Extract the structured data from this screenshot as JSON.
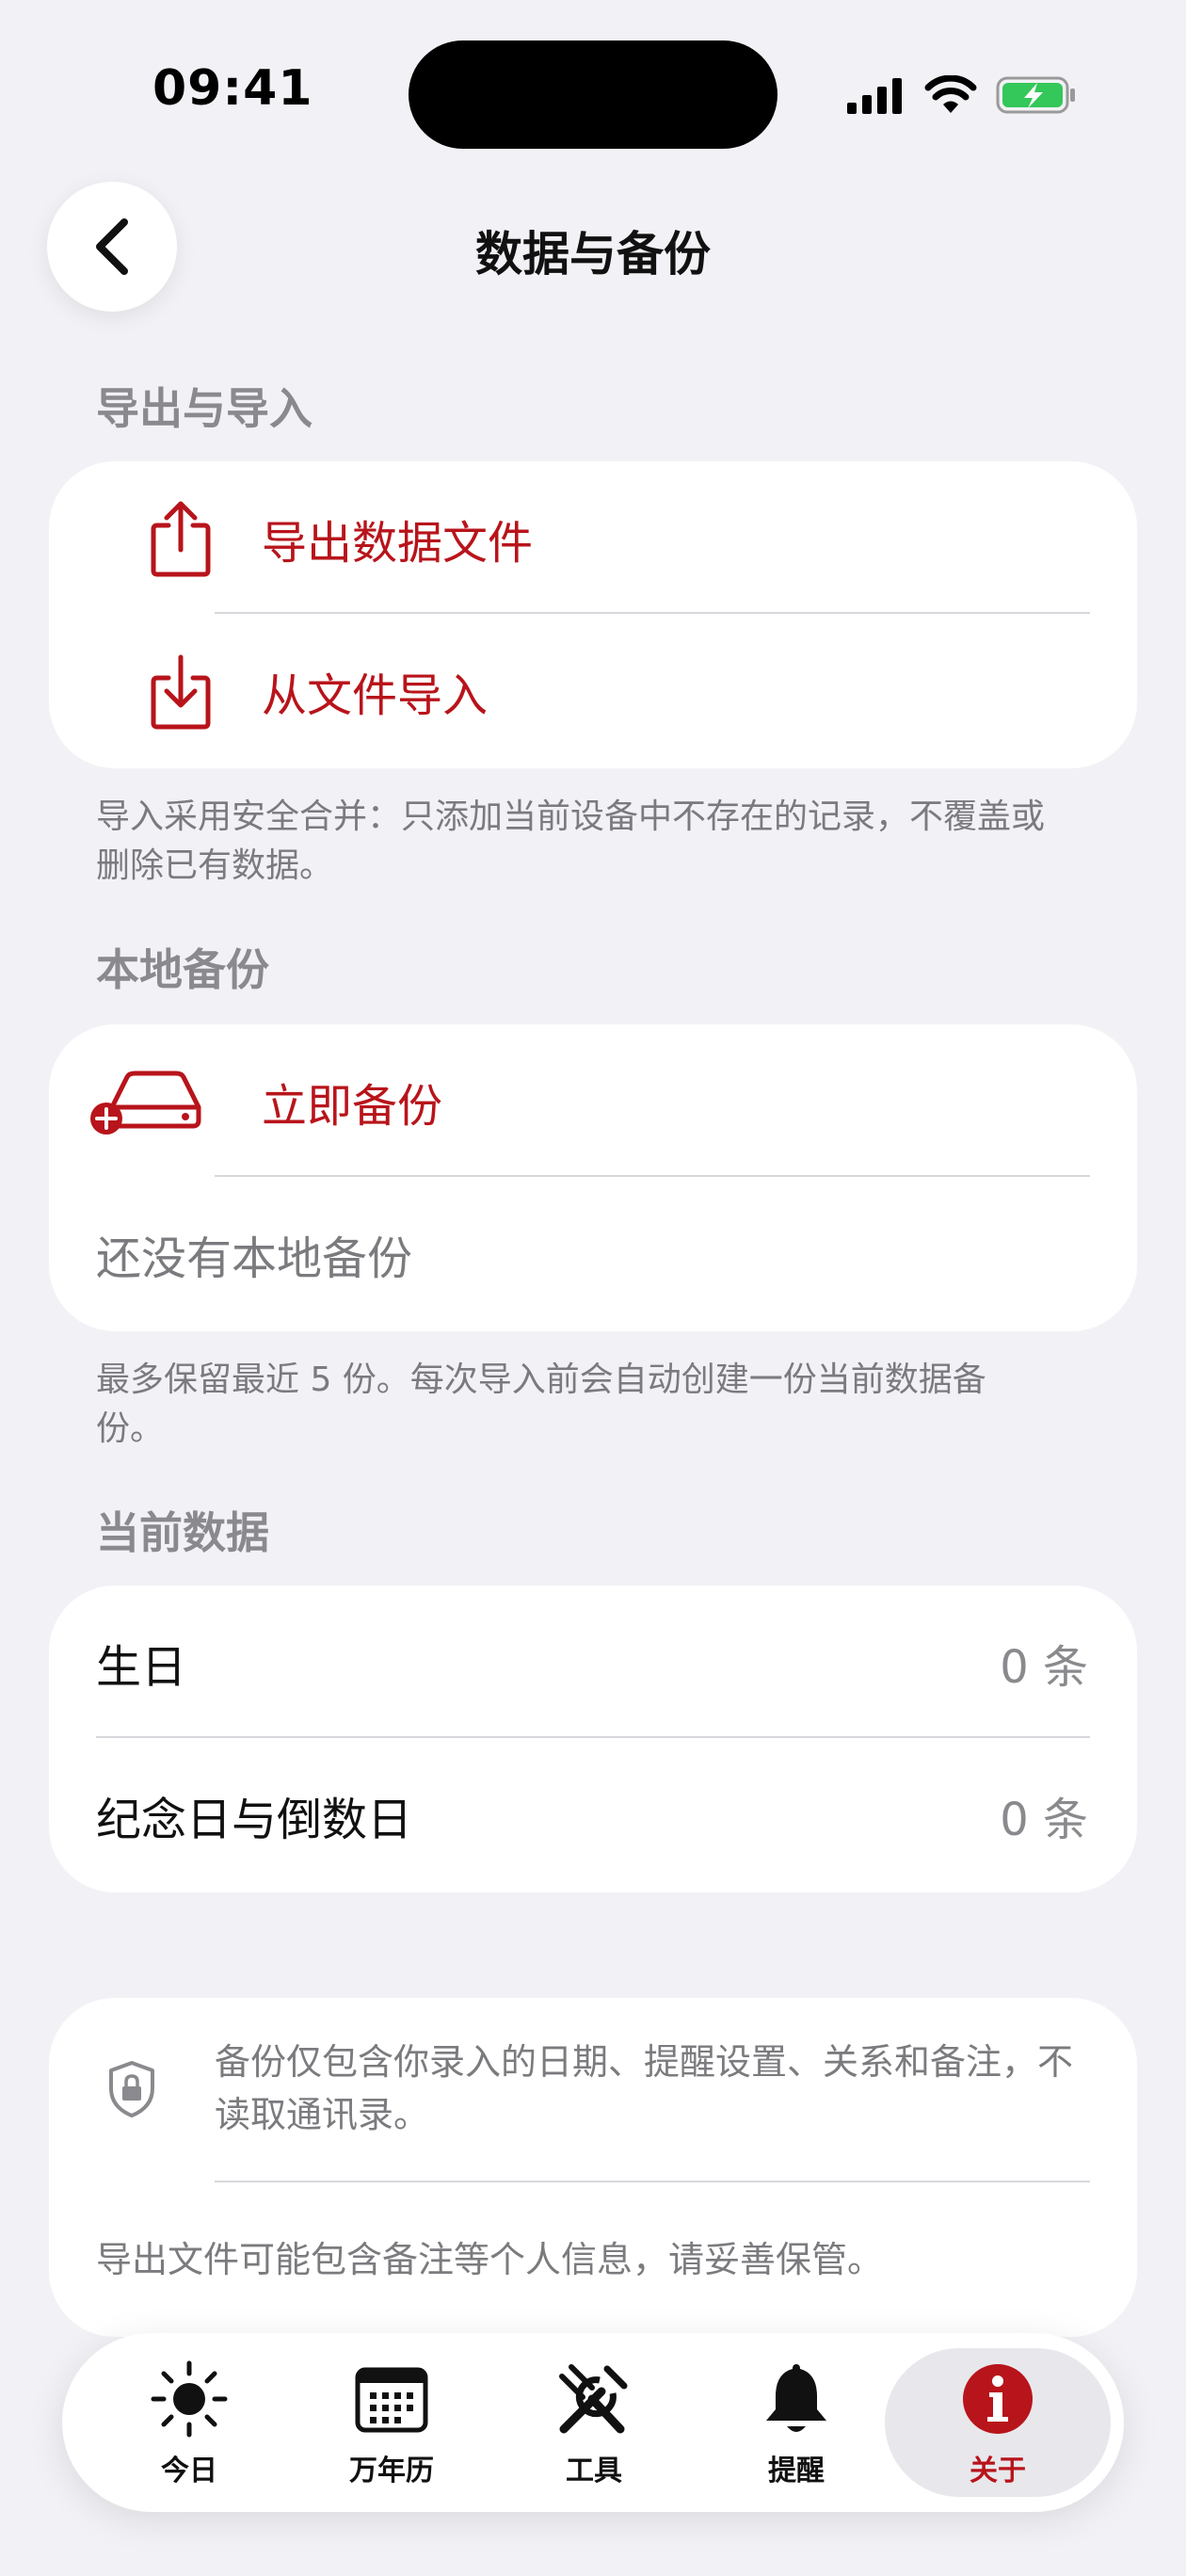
{
  "status_bar": {
    "time": "09:41"
  },
  "nav": {
    "title": "数据与备份"
  },
  "export_section": {
    "header": "导出与导入",
    "export_label": "导出数据文件",
    "import_label": "从文件导入",
    "note": "导入采用安全合并：只添加当前设备中不存在的记录，不覆盖或删除已有数据。"
  },
  "backup_section": {
    "header": "本地备份",
    "backup_now_label": "立即备份",
    "empty_label": "还没有本地备份",
    "note": "最多保留最近 5 份。每次导入前会自动创建一份当前数据备份。"
  },
  "current_data": {
    "header": "当前数据",
    "rows": [
      {
        "label": "生日",
        "value": "0 条"
      },
      {
        "label": "纪念日与倒数日",
        "value": "0 条"
      }
    ]
  },
  "privacy": {
    "main": "备份仅包含你录入的日期、提醒设置、关系和备注，不读取通讯录。",
    "footer": "导出文件可能包含备注等个人信息，请妥善保管。"
  },
  "tabbar": {
    "items": [
      {
        "label": "今日",
        "icon": "sun-icon"
      },
      {
        "label": "万年历",
        "icon": "calendar-icon"
      },
      {
        "label": "工具",
        "icon": "tools-icon"
      },
      {
        "label": "提醒",
        "icon": "bell-icon"
      },
      {
        "label": "关于",
        "icon": "info-icon"
      }
    ],
    "active_index": 4
  },
  "colors": {
    "accent": "#b8141b",
    "background": "#f2f2f6",
    "battery": "#34c759"
  }
}
